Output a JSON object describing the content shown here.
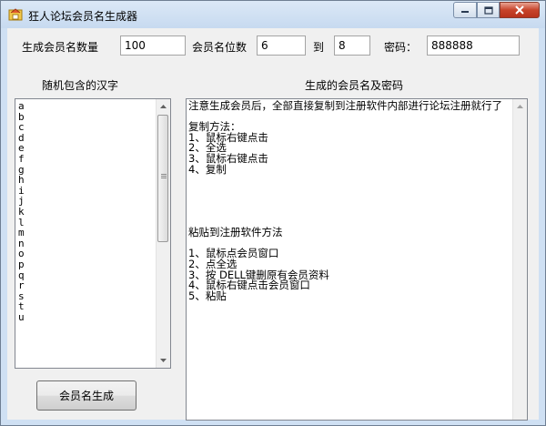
{
  "window": {
    "title": "狂人论坛会员名生成器"
  },
  "form": {
    "count_label": "生成会员名数量",
    "count_value": "100",
    "digits_label": "会员名位数",
    "digits_from": "6",
    "to_label": "到",
    "digits_to": "8",
    "password_label": "密码：",
    "password_value": "888888"
  },
  "left_panel": {
    "heading": "随机包含的汉字",
    "items": [
      "a",
      "b",
      "c",
      "d",
      "e",
      "f",
      "g",
      "h",
      "i",
      "j",
      "k",
      "l",
      "m",
      "n",
      "o",
      "p",
      "q",
      "r",
      "s",
      "t",
      "u"
    ]
  },
  "right_panel": {
    "heading": "生成的会员名及密码",
    "lines": [
      "注意生成会员后，全部直接复制到注册软件内部进行论坛注册就行了",
      "",
      "复制方法：",
      "1、鼠标右键点击",
      "2、全选",
      "3、鼠标右键点击",
      "4、复制",
      "",
      "",
      "",
      "",
      "",
      "粘贴到注册软件方法",
      "",
      "1、鼠标点会员窗口",
      "2、点全选",
      "3、按 DELL键删原有会员资料",
      "4、鼠标右键点击会员窗口",
      "5、粘贴"
    ]
  },
  "actions": {
    "generate_label": "会员名生成"
  },
  "icons": {
    "app": "app-icon",
    "minimize": "minimize-icon",
    "maximize": "maximize-icon",
    "close": "close-icon"
  }
}
